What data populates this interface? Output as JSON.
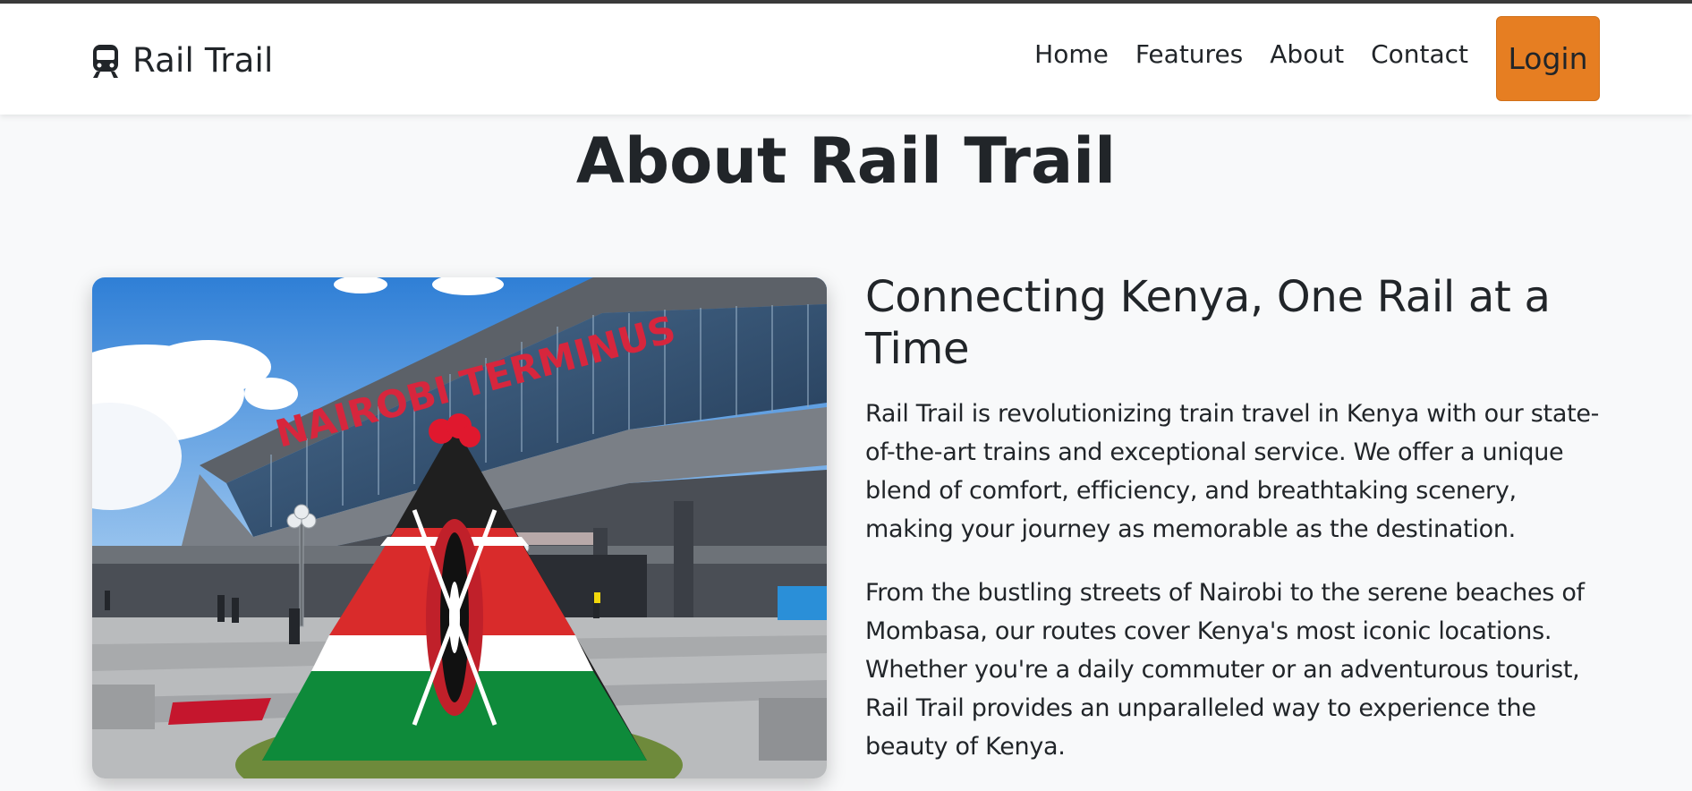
{
  "nav": {
    "brand": "Rail Trail",
    "brand_icon": "train-icon",
    "links": [
      "Home",
      "Features",
      "About",
      "Contact"
    ],
    "login_label": "Login",
    "login_color": "#e67e22"
  },
  "about": {
    "title": "About Rail Trail",
    "subtitle": "Connecting Kenya, One Rail at a Time",
    "paragraphs": [
      "Rail Trail is revolutionizing train travel in Kenya with our state-of-the-art trains and exceptional service. We offer a unique blend of comfort, efficiency, and breathtaking scenery, making your journey as memorable as the destination.",
      "From the bustling streets of Nairobi to the serene beaches of Mombasa, our routes cover Kenya's most iconic locations. Whether you're a daily commuter or an adventurous tourist, Rail Trail provides an unparalleled way to experience the beauty of Kenya."
    ],
    "image": {
      "subject": "Nairobi Terminus station with a Kenyan flag display",
      "sign_text": "NAIROBI TERMINUS"
    }
  }
}
